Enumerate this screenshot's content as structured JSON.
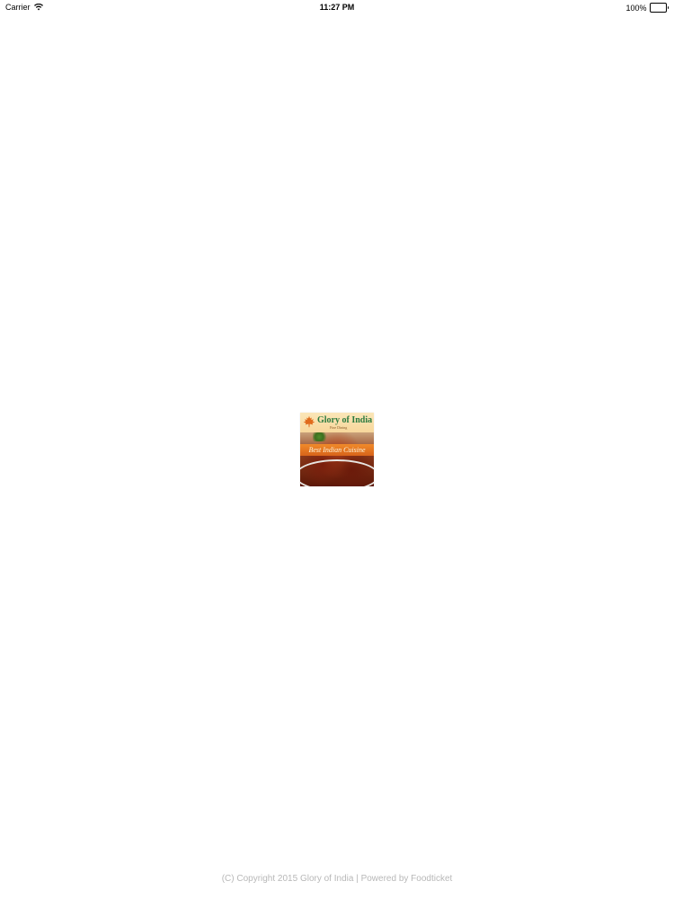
{
  "status_bar": {
    "carrier": "Carrier",
    "time": "11:27 PM",
    "battery_percent": "100%",
    "battery_level": 1.0,
    "icons": [
      "wifi-icon",
      "battery-icon"
    ]
  },
  "logo": {
    "title": "Glory of India",
    "subtitle": "Fine Dining",
    "tagline": "Best Indian Cuisine",
    "colors": {
      "title": "#2b7a3f",
      "banner": "#e5731f",
      "leaf": "#e06a1b",
      "header_bg": "#f8dca6"
    }
  },
  "footer": {
    "copyright": "(C) Copyright 2015 Glory of India | Powered by Foodticket"
  }
}
